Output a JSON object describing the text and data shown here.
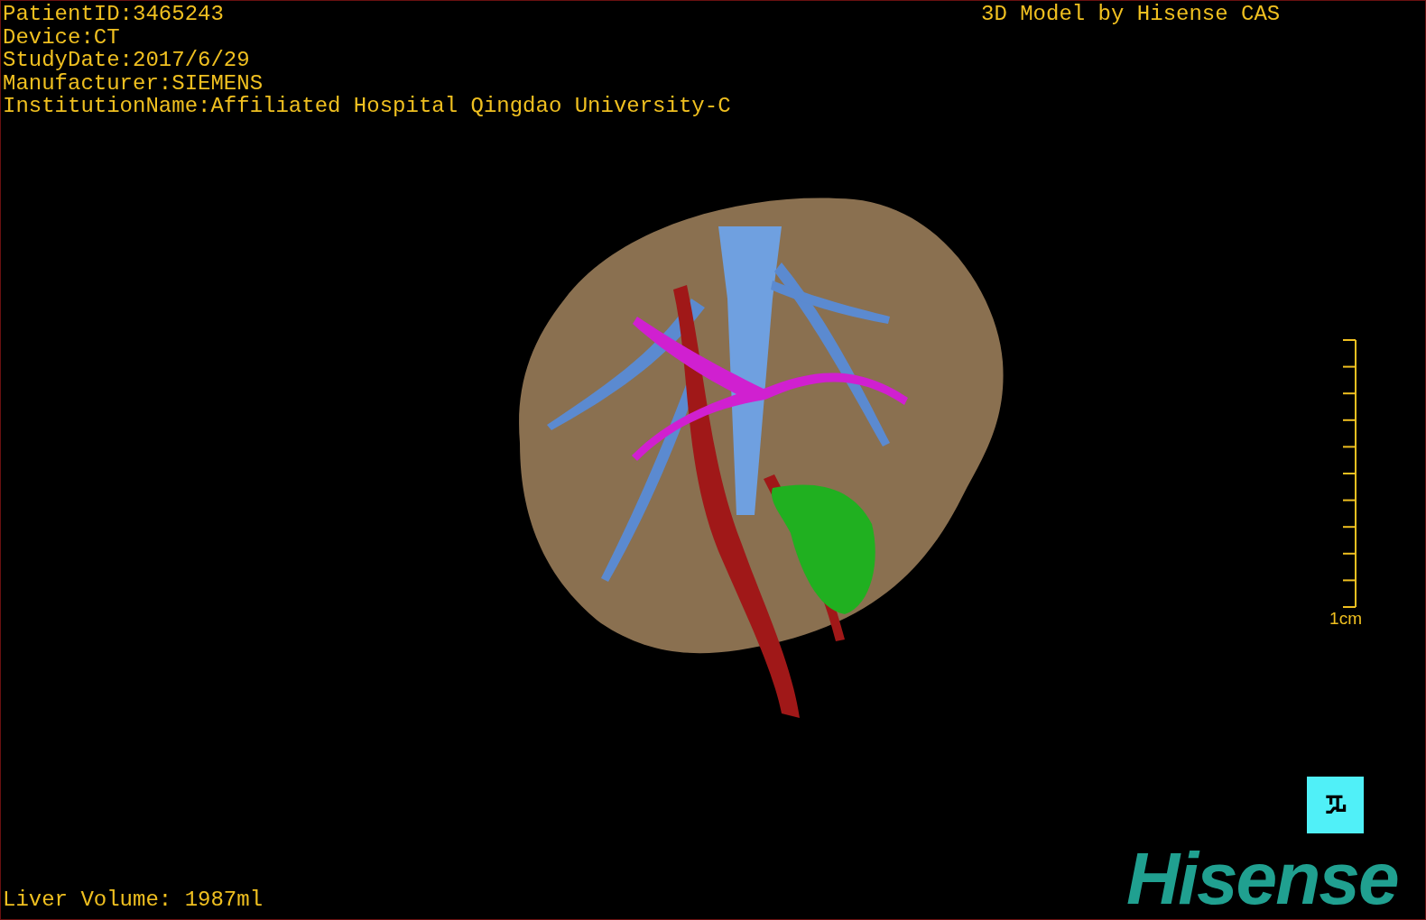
{
  "info_lines": [
    "PatientID:3465243",
    "Device:CT",
    "StudyDate:2017/6/29",
    "Manufacturer:SIEMENS",
    "InstitutionName:Affiliated Hospital Qingdao University-C"
  ],
  "credit": "3D Model by Hisense CAS",
  "scale_bar": {
    "label": "1cm"
  },
  "volume": "Liver Volume: 1987ml",
  "logo": "Hisense"
}
